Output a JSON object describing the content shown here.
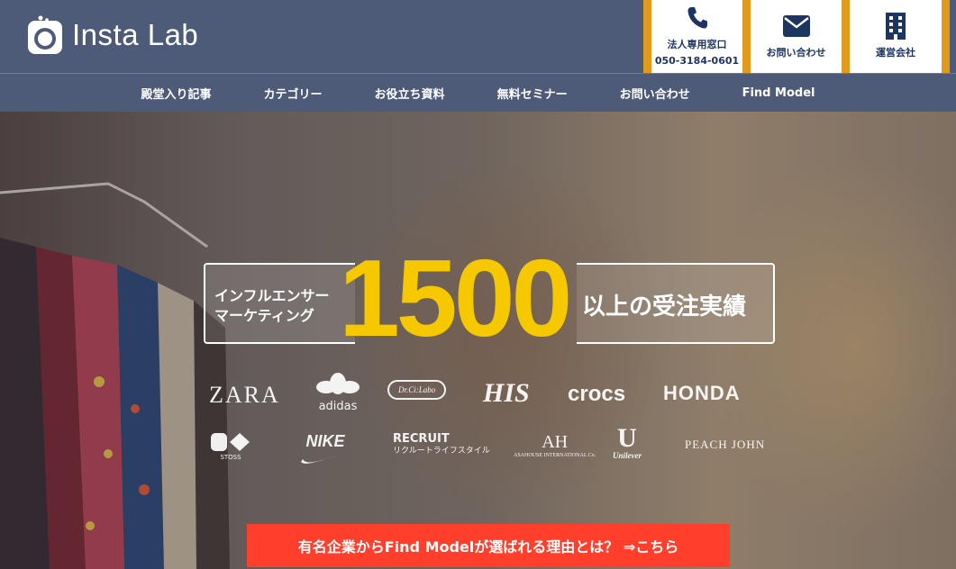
{
  "header": {
    "logo_text": "Insta Lab",
    "buttons": {
      "corp_label": "法人専用窓口",
      "corp_phone": "050-3184-0601",
      "contact_label": "お問い合わせ",
      "company_label": "運営会社"
    },
    "icons": {
      "corp": "phone-icon",
      "contact": "mail-icon",
      "company": "building-icon"
    },
    "accent_color": "#e19a1b",
    "bg_color": "#4e5b78"
  },
  "nav": {
    "items": [
      "殿堂入り記事",
      "カテゴリー",
      "お役立ち資料",
      "無料セミナー",
      "お問い合わせ",
      "Find Model"
    ]
  },
  "hero": {
    "headline_left": "インフルエンサー\nマーケティング",
    "headline_number": "1500",
    "headline_right": "以上の受注実績",
    "number_color": "#f5c800",
    "brands": [
      "ZARA",
      "adidas",
      "Dr.Ci:Labo",
      "HIS",
      "crocs",
      "HONDA",
      "STOSS",
      "NIKE",
      "RECRUIT",
      "リクルートライフスタイル",
      "AH",
      "ASAHOUSE INTERNATIONAL Co.",
      "U",
      "Unilever",
      "PEACH JOHN"
    ],
    "cta_label": "有名企業からFind Modelが選ばれる理由とは？ ⇒こちら",
    "cta_color": "#ff3f2c"
  }
}
